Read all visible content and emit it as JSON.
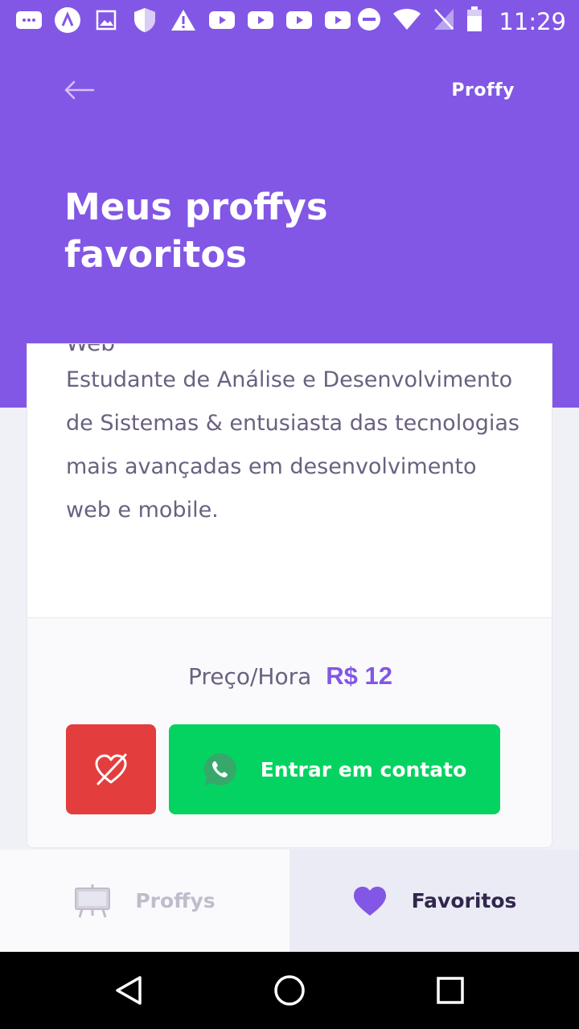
{
  "status_bar": {
    "time": "11:29",
    "icons": [
      "chat-icon",
      "app-icon",
      "image-icon",
      "shield-icon",
      "warning-icon",
      "youtube-icon",
      "youtube-icon",
      "youtube-icon",
      "youtube-icon",
      "do-not-disturb-icon",
      "wifi-icon",
      "no-signal-icon",
      "battery-icon"
    ]
  },
  "header": {
    "logo": "Proffy",
    "title": "Meus proffys favoritos"
  },
  "card": {
    "cut_text": "Web",
    "bio": "Estudante de Análise e Desenvolvimento  de Sistemas & entusiasta das tecnologias mais avançadas em desenvolvimento web e mobile.",
    "price_label": "Preço/Hora",
    "price_value": "R$ 12",
    "contact_label": "Entrar em contato"
  },
  "tabs": [
    {
      "label": "Proffys",
      "icon": "easel-icon",
      "active": false
    },
    {
      "label": "Favoritos",
      "icon": "heart-icon",
      "active": true
    }
  ],
  "colors": {
    "primary": "#8257E5",
    "danger": "#E33D3D",
    "success": "#04D361"
  }
}
